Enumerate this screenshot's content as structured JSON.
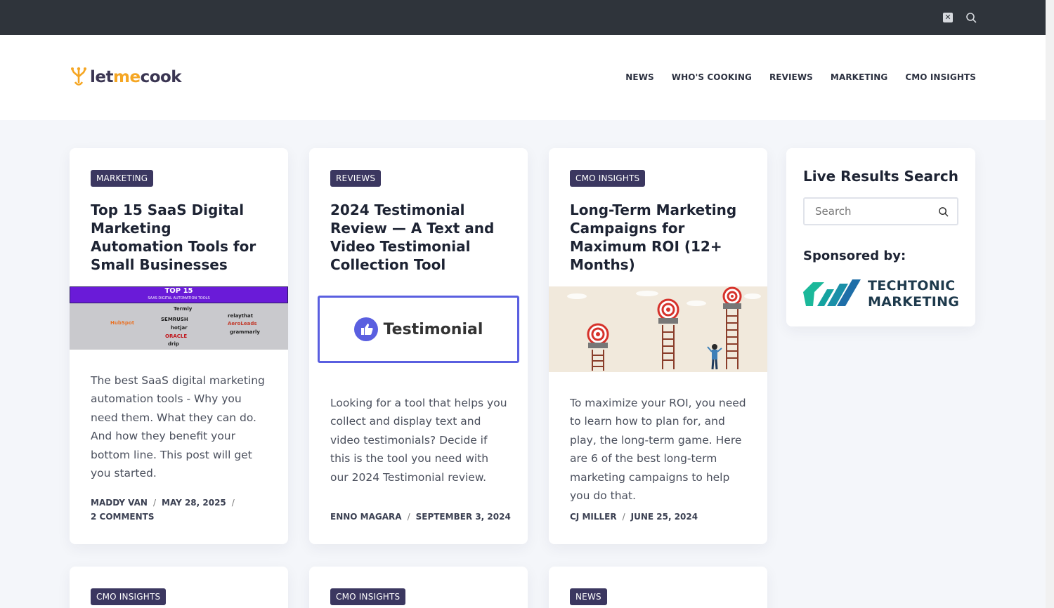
{
  "brand": {
    "name_part1": "let",
    "name_part2": "me",
    "name_part3": "cook",
    "accent": "#f5a623",
    "dark": "#3a3552"
  },
  "topbar": {
    "icons": [
      "x-social-icon",
      "search-icon"
    ]
  },
  "nav": {
    "items": [
      "NEWS",
      "WHO'S COOKING",
      "REVIEWS",
      "MARKETING",
      "CMO INSIGHTS"
    ]
  },
  "posts": [
    {
      "category": "MARKETING",
      "title": "Top 15 SaaS Digital Marketing Automation Tools for Small Businesses",
      "thumb": {
        "heading": "TOP 15",
        "subheading": "SAAS DIGITAL AUTOMATION TOOLS",
        "logos": [
          "Termly",
          "SEMRUSH",
          "hotjar",
          "ORACLE",
          "drip",
          "HubSpot",
          "relaythat",
          "AeroLeads",
          "grammarly"
        ]
      },
      "excerpt": "The best SaaS digital marketing automation tools - Why you need them. What they can do. And how they benefit your bottom line. This post will get you started.",
      "author": "MADDY VAN",
      "date": "MAY 28, 2025",
      "comments": "2 COMMENTS"
    },
    {
      "category": "REVIEWS",
      "title": "2024 Testimonial Review — A Text and Video Testimonial Collection Tool",
      "thumb": {
        "label": "Testimonial"
      },
      "excerpt": "Looking for a tool that helps you collect and display text and video testimonials? Decide if this is the tool you need with our 2024 Testimonial review.",
      "author": "ENNO MAGARA",
      "date": "SEPTEMBER 3, 2024"
    },
    {
      "category": "CMO INSIGHTS",
      "title": "Long-Term Marketing Campaigns for Maximum ROI (12+ Months)",
      "excerpt": "To maximize your ROI, you need to learn how to plan for, and play, the long-term game. Here are 6 of the best long-term marketing campaigns to help you do that.",
      "author": "CJ MILLER",
      "date": "JUNE 25, 2024"
    }
  ],
  "next_row": [
    {
      "category": "CMO INSIGHTS"
    },
    {
      "category": "CMO INSIGHTS"
    },
    {
      "category": "NEWS"
    }
  ],
  "sidebar": {
    "search_title": "Live Results Search",
    "search_placeholder": "Search",
    "sponsor_label": "Sponsored by:",
    "sponsor_line1": "TECHTONIC",
    "sponsor_line2": "MARKETING"
  },
  "colors": {
    "badge": "#3b3760",
    "topbar": "#2f343b",
    "testimonial_border": "#5a5fe0"
  }
}
